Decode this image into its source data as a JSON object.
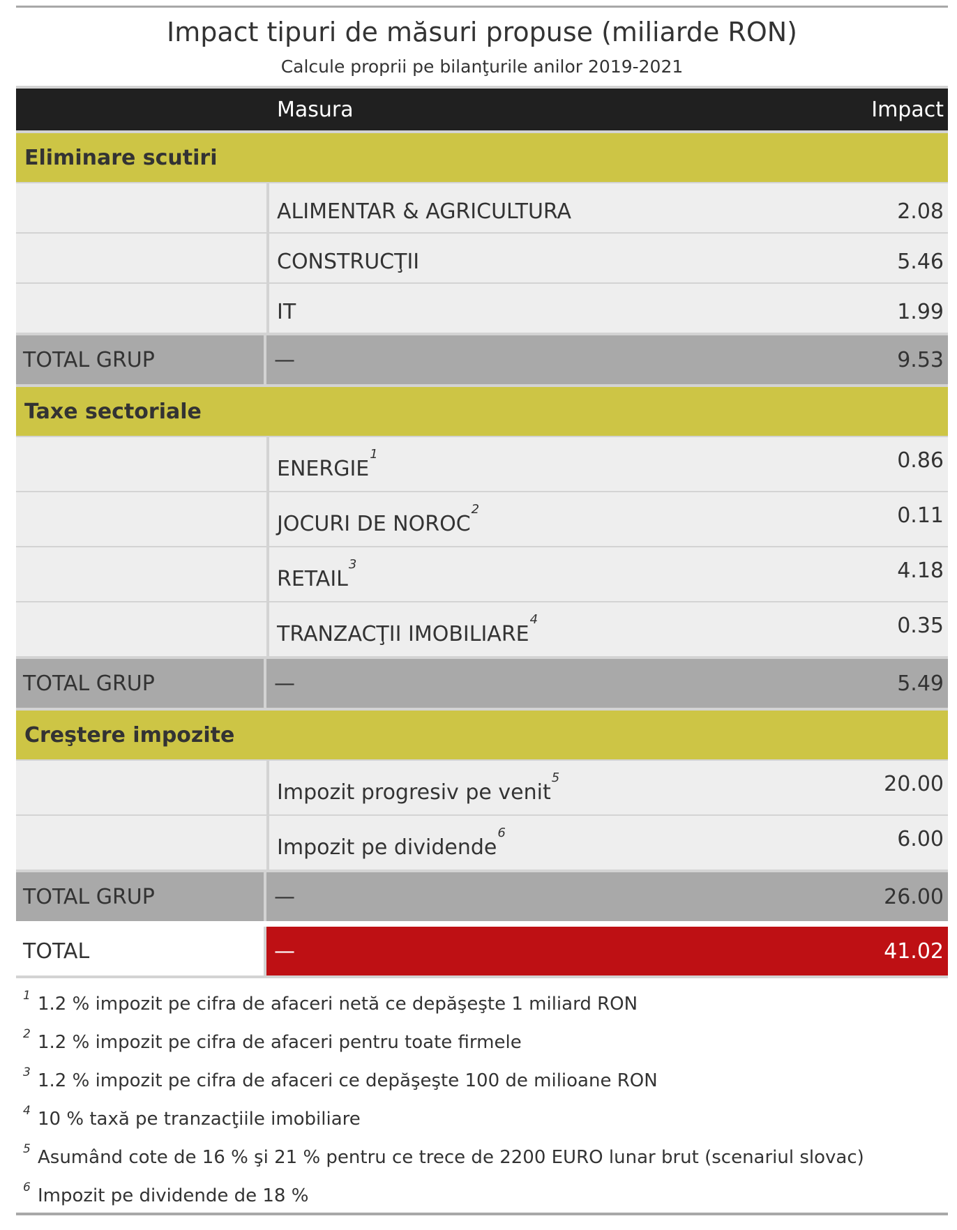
{
  "chart_data": {
    "type": "table",
    "title": "Impact tipuri de măsuri propuse (miliarde RON)",
    "subtitle": "Calcule proprii pe bilanţurile anilor 2019-2021",
    "columns": [
      "Masura",
      "Impact"
    ],
    "groups": [
      {
        "name": "Eliminare scutiri",
        "rows": [
          {
            "measure": "ALIMENTAR & AGRICULTURA",
            "note": "",
            "impact": "2.08"
          },
          {
            "measure": "CONSTRUCŢII",
            "note": "",
            "impact": "5.46"
          },
          {
            "measure": "IT",
            "note": "",
            "impact": "1.99"
          }
        ],
        "total_label": "TOTAL GRUP",
        "total_measure": "—",
        "total": "9.53"
      },
      {
        "name": "Taxe sectoriale",
        "rows": [
          {
            "measure": "ENERGIE",
            "note": "1",
            "impact": "0.86"
          },
          {
            "measure": "JOCURI DE NOROC",
            "note": "2",
            "impact": "0.11"
          },
          {
            "measure": "RETAIL",
            "note": "3",
            "impact": "4.18"
          },
          {
            "measure": "TRANZACŢII IMOBILIARE",
            "note": "4",
            "impact": "0.35"
          }
        ],
        "total_label": "TOTAL GRUP",
        "total_measure": "—",
        "total": "5.49"
      },
      {
        "name": "Creştere impozite",
        "rows": [
          {
            "measure": "Impozit progresiv pe venit",
            "note": "5",
            "impact": "20.00"
          },
          {
            "measure": "Impozit pe dividende",
            "note": "6",
            "impact": "6.00"
          }
        ],
        "total_label": "TOTAL GRUP",
        "total_measure": "—",
        "total": "26.00"
      }
    ],
    "grand_total": {
      "label": "TOTAL",
      "measure": "—",
      "value": "41.02"
    },
    "footnotes": [
      {
        "mark": "1",
        "text": "1.2 % impozit pe cifra de afaceri netă ce depăşeşte 1 miliard RON"
      },
      {
        "mark": "2",
        "text": "1.2 % impozit pe cifra de afaceri pentru toate firmele"
      },
      {
        "mark": "3",
        "text": "1.2 % impozit pe cifra de afaceri ce depăşeşte 100 de milioane RON"
      },
      {
        "mark": "4",
        "text": "10 % taxă pe tranzacţiile imobiliare"
      },
      {
        "mark": "5",
        "text": "Asumând cote de 16 % şi 21 % pentru ce trece de 2200 EURO lunar brut (scenariul slovac)"
      },
      {
        "mark": "6",
        "text": "Impozit pe dividende de 18 %"
      }
    ],
    "colors": {
      "header_bg": "#202020",
      "group_bg": "#cdc545",
      "row_bg": "#eeeeee",
      "subtotal_bg": "#a9a9a9",
      "total_bg": "#be1014"
    }
  }
}
